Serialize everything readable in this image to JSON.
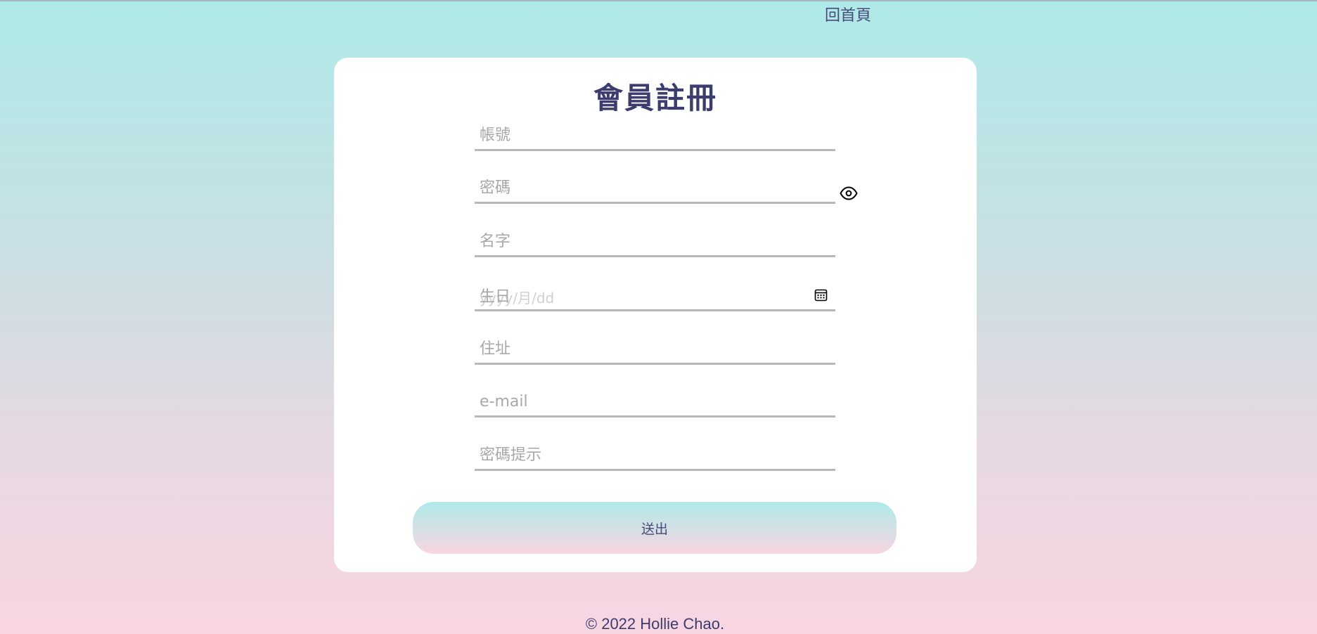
{
  "nav": {
    "home_label": "回首頁"
  },
  "form": {
    "title": "會員註冊",
    "fields": {
      "account": {
        "placeholder": "帳號"
      },
      "password": {
        "placeholder": "密碼"
      },
      "name": {
        "placeholder": "名字"
      },
      "birthday": {
        "label": "生日",
        "format_placeholder": "yyyy/月/dd"
      },
      "address": {
        "placeholder": "住址"
      },
      "email": {
        "placeholder": "e-mail"
      },
      "password_hint": {
        "placeholder": "密碼提示"
      }
    },
    "submit_label": "送出"
  },
  "footer": {
    "copyright": "© 2022 Hollie Chao."
  },
  "icons": {
    "password_toggle": "eye-icon",
    "date_picker": "calendar-icon"
  },
  "colors": {
    "gradient_top": "#aeeae8",
    "gradient_bottom": "#f8d6e2",
    "title": "#3c3c6e"
  }
}
